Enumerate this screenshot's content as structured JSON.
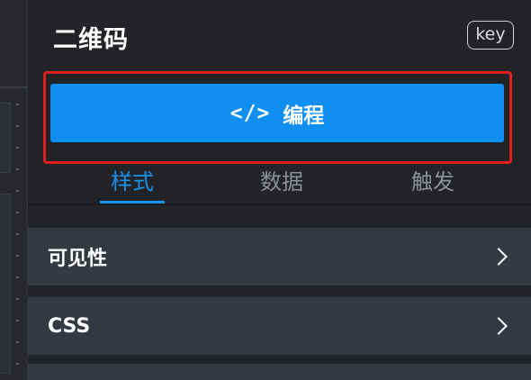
{
  "panel": {
    "title": "二维码",
    "key_badge": "key"
  },
  "code_button": {
    "glyph": "</>",
    "label": "编程"
  },
  "tabs": [
    {
      "label": "样式",
      "active": true
    },
    {
      "label": "数据",
      "active": false
    },
    {
      "label": "触发",
      "active": false
    }
  ],
  "sections": [
    {
      "label": "可见性"
    },
    {
      "label": "CSS"
    }
  ],
  "colors": {
    "accent": "#0e8ff1",
    "highlight_frame": "#e01e1e",
    "section_bg": "#353a42",
    "panel_bg": "#212327"
  }
}
